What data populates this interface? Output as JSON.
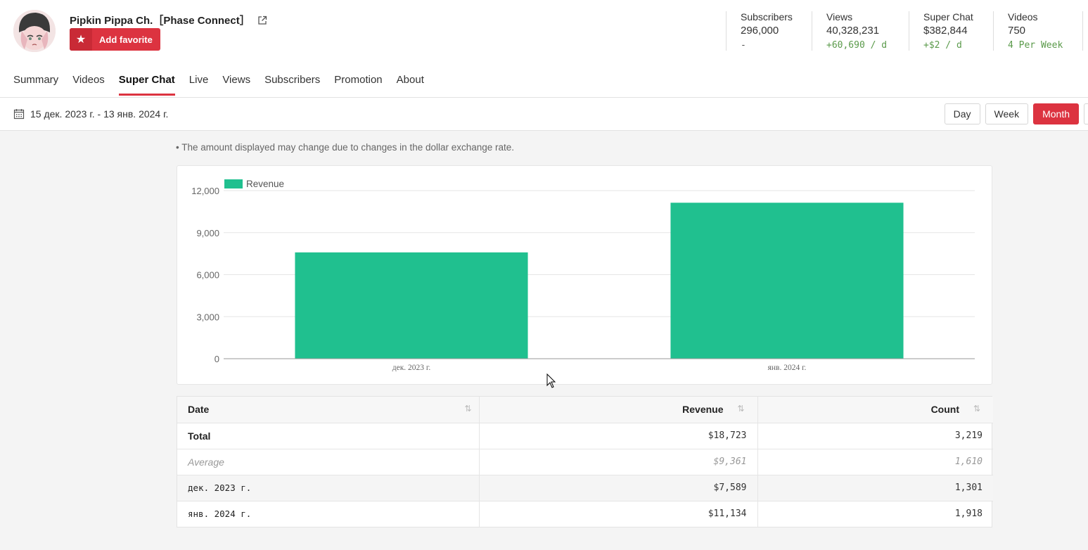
{
  "channel": {
    "name": "Pipkin Pippa Ch.［Phase Connect］",
    "favorite_label": "Add favorite"
  },
  "stats": [
    {
      "label": "Subscribers",
      "value": "296,000",
      "delta": "-"
    },
    {
      "label": "Views",
      "value": "40,328,231",
      "delta": "+60,690 / d"
    },
    {
      "label": "Super Chat",
      "value": "$382,844",
      "delta": "+$2 / d"
    },
    {
      "label": "Videos",
      "value": "750",
      "delta": "4 Per Week"
    }
  ],
  "tabs": [
    {
      "label": "Summary",
      "active": false
    },
    {
      "label": "Videos",
      "active": false
    },
    {
      "label": "Super Chat",
      "active": true
    },
    {
      "label": "Live",
      "active": false
    },
    {
      "label": "Views",
      "active": false
    },
    {
      "label": "Subscribers",
      "active": false
    },
    {
      "label": "Promotion",
      "active": false
    },
    {
      "label": "About",
      "active": false
    }
  ],
  "toolbar": {
    "date_range": "15 дек. 2023 г. - 13 янв. 2024 г.",
    "periods": [
      {
        "label": "Day",
        "active": false
      },
      {
        "label": "Week",
        "active": false
      },
      {
        "label": "Month",
        "active": true
      }
    ]
  },
  "note": "• The amount displayed may change due to changes in the dollar exchange rate.",
  "colors": {
    "accent": "#dc3340",
    "bar": "#20c08f",
    "positive_delta": "#5a9a4a"
  },
  "chart_data": {
    "type": "bar",
    "title": "",
    "xlabel": "",
    "ylabel": "",
    "categories": [
      "дек. 2023 г.",
      "янв. 2024 г."
    ],
    "series": [
      {
        "name": "Revenue",
        "values": [
          7589,
          11134
        ]
      }
    ],
    "ylim": [
      0,
      12000
    ],
    "yticks": [
      0,
      3000,
      6000,
      9000,
      12000
    ],
    "ytick_labels": [
      "0",
      "3,000",
      "6,000",
      "9,000",
      "12,000"
    ],
    "grid": true,
    "legend": "top-left"
  },
  "table": {
    "headers": [
      "Date",
      "Revenue",
      "Count"
    ],
    "sort_icon": "sort-arrows-icon",
    "rows": [
      {
        "type": "total",
        "date": "Total",
        "revenue": "$18,723",
        "count": "3,219"
      },
      {
        "type": "avg",
        "date": "Average",
        "revenue": "$9,361",
        "count": "1,610"
      },
      {
        "type": "month",
        "date": "дек. 2023 г.",
        "revenue": "$7,589",
        "count": "1,301"
      },
      {
        "type": "month",
        "date": "янв. 2024 г.",
        "revenue": "$11,134",
        "count": "1,918"
      }
    ]
  }
}
